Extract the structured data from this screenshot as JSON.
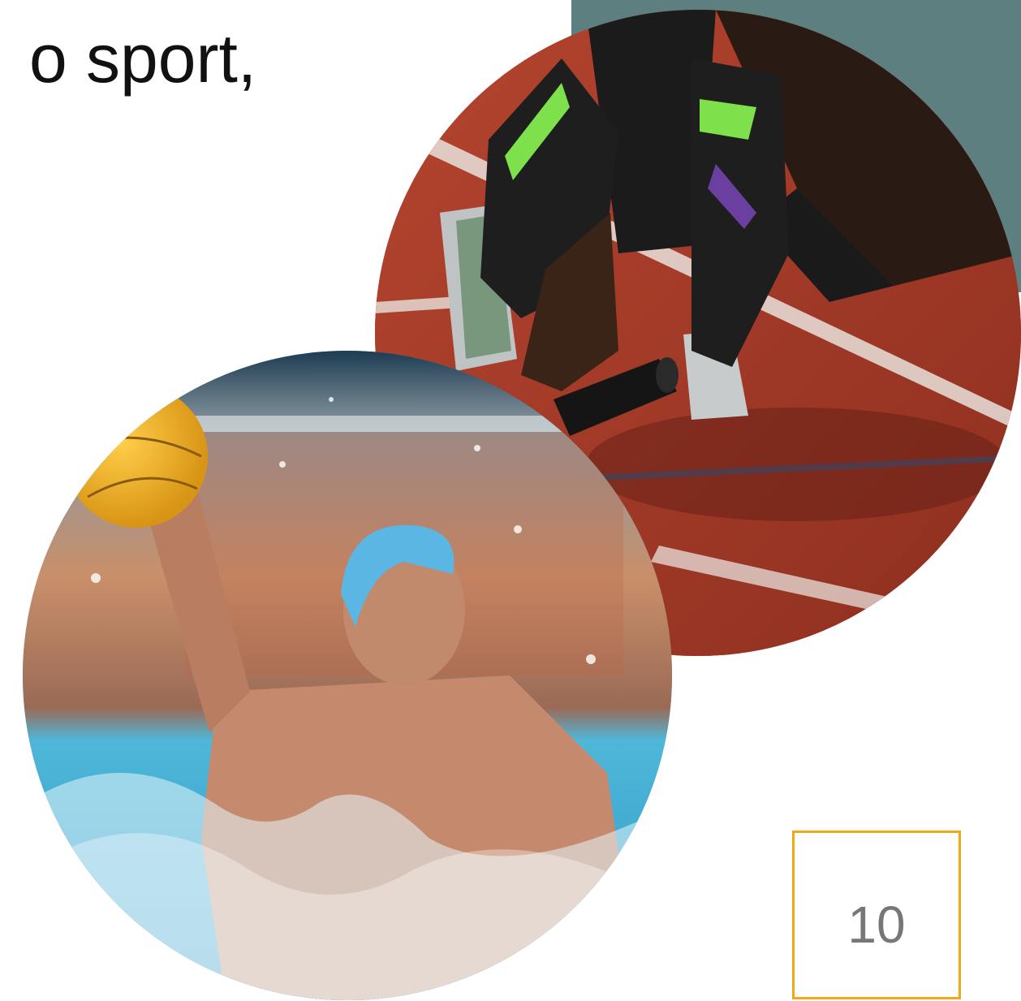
{
  "slide": {
    "heading": "o sport,",
    "page_number": "10"
  },
  "colors": {
    "accent_panel": "#5e7f7f",
    "page_box_border": "#f0a818",
    "track_surface": "#a63a28",
    "pool_water": "#3a9fc8"
  },
  "images": [
    {
      "name": "sprinter-starting-blocks-photo",
      "subject": "sprinter-on-track"
    },
    {
      "name": "water-polo-player-photo",
      "subject": "water-polo-player"
    }
  ]
}
